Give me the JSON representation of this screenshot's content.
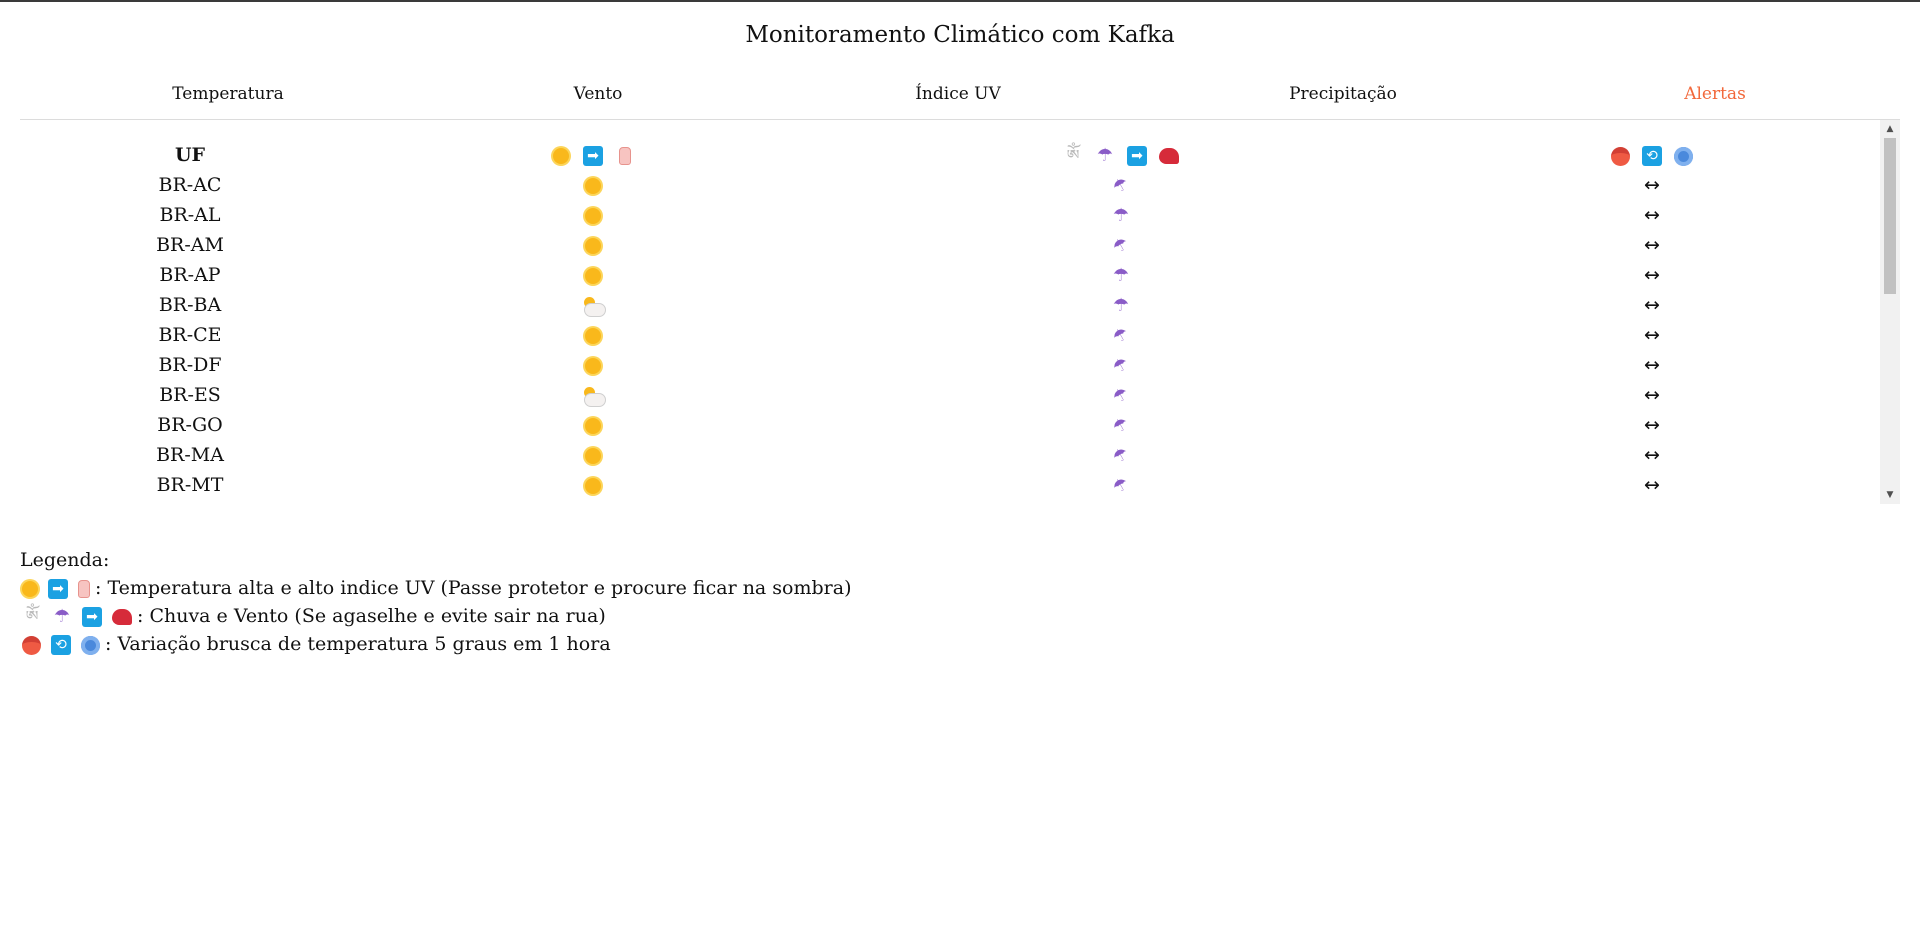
{
  "title": "Monitoramento Climático com Kafka",
  "tabs": [
    {
      "label": "Temperatura",
      "active": false
    },
    {
      "label": "Vento",
      "active": false
    },
    {
      "label": "Índice UV",
      "active": false
    },
    {
      "label": "Precipitação",
      "active": false
    },
    {
      "label": "Alertas",
      "active": true
    }
  ],
  "accent_color": "#f2683b",
  "table": {
    "header_label": "UF",
    "header_icons": {
      "group1": [
        "sun-icon",
        "arrow-right-icon",
        "lotion-icon"
      ],
      "group2": [
        "wind-icon",
        "umbrella-icon",
        "arrow-right-icon",
        "cap-icon"
      ],
      "group3": [
        "hot-face-icon",
        "repeat-icon",
        "cold-face-icon"
      ]
    },
    "rows": [
      {
        "uf": "BR-AC",
        "temp_icon": "sun-icon",
        "rain_icon": "closed-umbrella-icon",
        "variation": "↔"
      },
      {
        "uf": "BR-AL",
        "temp_icon": "sun-icon",
        "rain_icon": "umbrella-icon",
        "variation": "↔"
      },
      {
        "uf": "BR-AM",
        "temp_icon": "sun-icon",
        "rain_icon": "closed-umbrella-icon",
        "variation": "↔"
      },
      {
        "uf": "BR-AP",
        "temp_icon": "sun-icon",
        "rain_icon": "umbrella-icon",
        "variation": "↔"
      },
      {
        "uf": "BR-BA",
        "temp_icon": "cloud-sun-icon",
        "rain_icon": "umbrella-icon",
        "variation": "↔"
      },
      {
        "uf": "BR-CE",
        "temp_icon": "sun-icon",
        "rain_icon": "closed-umbrella-icon",
        "variation": "↔"
      },
      {
        "uf": "BR-DF",
        "temp_icon": "sun-icon",
        "rain_icon": "closed-umbrella-icon",
        "variation": "↔"
      },
      {
        "uf": "BR-ES",
        "temp_icon": "cloud-sun-icon",
        "rain_icon": "closed-umbrella-icon",
        "variation": "↔"
      },
      {
        "uf": "BR-GO",
        "temp_icon": "sun-icon",
        "rain_icon": "closed-umbrella-icon",
        "variation": "↔"
      },
      {
        "uf": "BR-MA",
        "temp_icon": "sun-icon",
        "rain_icon": "closed-umbrella-icon",
        "variation": "↔"
      },
      {
        "uf": "BR-MT",
        "temp_icon": "sun-icon",
        "rain_icon": "closed-umbrella-icon",
        "variation": "↔"
      }
    ]
  },
  "legend": {
    "title": "Legenda:",
    "items": [
      {
        "icons": [
          "sun-icon",
          "arrow-right-icon",
          "lotion-icon"
        ],
        "text": ": Temperatura alta e alto indice UV (Passe protetor e procure ficar na sombra)"
      },
      {
        "icons": [
          "wind-icon",
          "umbrella-icon",
          "arrow-right-icon",
          "cap-icon"
        ],
        "text": ": Chuva e Vento (Se agaselhe e evite sair na rua)"
      },
      {
        "icons": [
          "hot-face-icon",
          "repeat-icon",
          "cold-face-icon"
        ],
        "text": ": Variação brusca de temperatura 5 graus em 1 hora"
      }
    ]
  }
}
